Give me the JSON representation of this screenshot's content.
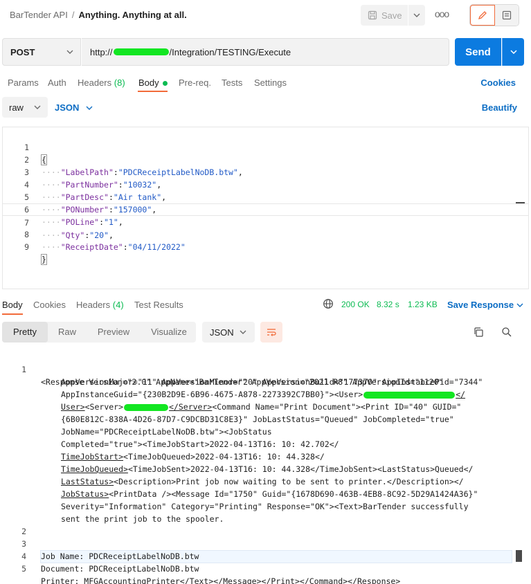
{
  "header": {
    "collection": "BarTender API",
    "separator": "/",
    "request_name": "Anything. Anything at all.",
    "save_label": "Save",
    "more_label": "ooo"
  },
  "url_bar": {
    "method": "POST",
    "url_prefix": "http://",
    "url_suffix": "/Integration/TESTING/Execute",
    "send_label": "Send"
  },
  "request_tabs": {
    "params": "Params",
    "auth": "Auth",
    "headers": "Headers",
    "headers_count": "(8)",
    "body": "Body",
    "prereq": "Pre-req.",
    "tests": "Tests",
    "settings": "Settings",
    "cookies": "Cookies"
  },
  "body_bar": {
    "mode": "raw",
    "language": "JSON",
    "beautify": "Beautify"
  },
  "request_body": {
    "line_numbers": [
      "1",
      "2",
      "3",
      "4",
      "5",
      "6",
      "7",
      "8",
      "9"
    ],
    "open_brace": "{",
    "close_brace": "}",
    "fields": [
      {
        "key": "\"LabelPath\"",
        "value": "\"PDCReceiptLabelNoDB.btw\"",
        "comma": ","
      },
      {
        "key": "\"PartNumber\"",
        "value": "\"10032\"",
        "comma": ","
      },
      {
        "key": "\"PartDesc\"",
        "value": "\"Air tank\"",
        "comma": ","
      },
      {
        "key": "\"PONumber\"",
        "value": "\"157000\"",
        "comma": ","
      },
      {
        "key": "\"POLine\"",
        "value": "\"1\"",
        "comma": ","
      },
      {
        "key": "\"Qty\"",
        "value": "\"20\"",
        "comma": ","
      },
      {
        "key": "\"ReceiptDate\"",
        "value": "\"04/11/2022\"",
        "comma": ""
      }
    ],
    "indent": "····"
  },
  "response_tabs": {
    "body": "Body",
    "cookies": "Cookies",
    "headers": "Headers",
    "headers_count": "(4)",
    "test_results": "Test Results",
    "status": "200 OK",
    "time": "8.32 s",
    "size": "1.23 KB",
    "save_response": "Save Response"
  },
  "response_toolbar": {
    "pretty": "Pretty",
    "raw": "Raw",
    "preview": "Preview",
    "visualize": "Visualize",
    "format": "JSON"
  },
  "response_body": {
    "line_numbers": [
      "1",
      "2",
      "3",
      "4",
      "5"
    ],
    "l1a": "<Response Version=\"2.0\" AppName=\"BarTender\" AppVersion=\"2021 R8\" AppVersionId=\"1120\"",
    "l1b": "AppVersionMajor=\"11\" AppVersionMinor=\"20\" AppVersionBuild=\"177370\" AppInstancePid=\"7344\"",
    "l1c_a": "AppInstanceGuid=\"{230B2D9E-6B96-4675-A878-2273392C7BB0}\"><User>",
    "l1c_b": "</",
    "l1d_a": "User>",
    "l1d_b": "<Server>",
    "l1d_c": "</Server>",
    "l1d_d": "<Command Name=\"Print Document\"><Print ID=\"40\" GUID=\"",
    "l1e": "{6B0E812C-838A-4D26-87D7-C9DCBD31C8E3}\" JobLastStatus=\"Queued\" JobCompleted=\"true\"",
    "l1f": "JobName=\"PDCReceiptLabelNoDB.btw\"><JobStatus",
    "l1g_a": "Completed=\"true\"><TimeJobStart>2022-04-13T16: 10: 42.702</",
    "l1h_a": "TimeJobStart>",
    "l1h_b": "<TimeJobQueued>2022-04-13T16: 10: 44.328</",
    "l1i_a": "TimeJobQueued>",
    "l1i_b": "<TimeJobSent>2022-04-13T16: 10: 44.328</TimeJobSent>",
    "l1i_c": "<LastStatus>Queued</",
    "l1j_a": "LastStatus>",
    "l1j_b": "<Description>Print job now waiting to be sent to printer.</Description>",
    "l1j_c": "</",
    "l1k_a": "JobStatus>",
    "l1k_b": "<PrintData /><Message Id=\"1750\" Guid=\"{1678D690-463B-4EB8-8C92-5D29A1424A36}\"",
    "l1l": "Severity=\"Information\" Category=\"Printing\" Response=\"OK\"><Text>BarTender successfully",
    "l1m": "sent the print job to the spooler.",
    "l3": "Job Name: PDCReceiptLabelNoDB.btw",
    "l4": "Document: PDCReceiptLabelNoDB.btw",
    "l5_a": "Printer: MFGAccountingPrinter",
    "l5_b": "</Text></Message></Print></Command></Response>"
  },
  "colors": {
    "accent": "#f26b3a",
    "send": "#0c7be0",
    "link": "#0c6dc4",
    "success": "#0cbb52",
    "redaction": "#13e622"
  }
}
